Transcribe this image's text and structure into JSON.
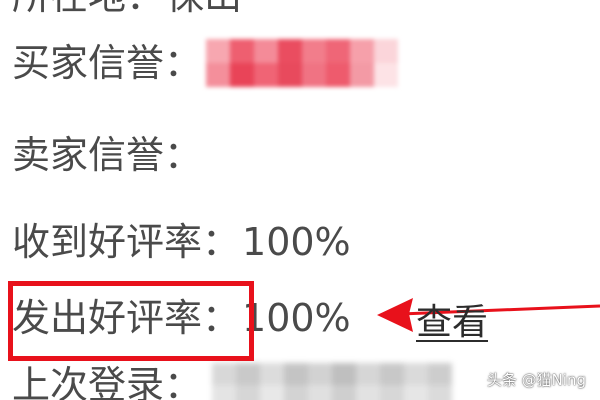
{
  "fields": {
    "location": {
      "label": "所在地：",
      "value": "保山"
    },
    "buyer_credit": {
      "label": "买家信誉："
    },
    "seller_credit": {
      "label": "卖家信誉："
    },
    "received_rate": {
      "label": "收到好评率：",
      "value": "100%"
    },
    "sent_rate": {
      "label": "发出好评率：",
      "value": "100%"
    },
    "last_login": {
      "label": "上次登录："
    }
  },
  "view_link": "查看",
  "watermark": "头条 @猫Ning",
  "colors": {
    "text": "#4a4a4a",
    "highlight_red": "#e8111b",
    "arrow_red": "#e8111b",
    "mosaic_pink": "#f06a78",
    "mosaic_gray": "#cfcfcf"
  },
  "icons": {
    "arrow": "arrow-left-icon"
  }
}
